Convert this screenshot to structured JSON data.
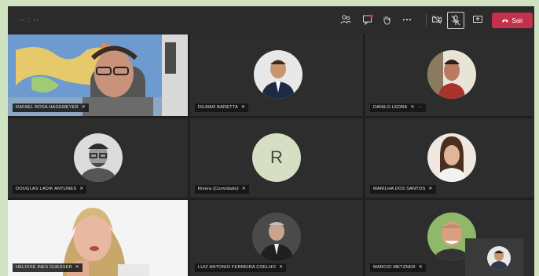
{
  "topbar": {
    "timer": "-- : --",
    "leave_label": "Sair",
    "leave_color": "#c4314b",
    "icons": [
      "participants-icon",
      "chat-icon",
      "raise-hand-icon",
      "more-options-icon",
      "camera-off-icon",
      "mic-off-icon",
      "share-screen-icon",
      "phone-icon"
    ]
  },
  "participants": [
    {
      "name": "RAFAEL ROSA HAGEMEYER",
      "type": "video"
    },
    {
      "name": "DILMAR BARETTA",
      "type": "avatar"
    },
    {
      "name": "DANILO LEDRA",
      "type": "avatar",
      "extra": "···"
    },
    {
      "name": "DOUGLAS LADIK ANTUNES",
      "type": "avatar"
    },
    {
      "name": "Rivera (Convidado)",
      "type": "initial",
      "initial": "R"
    },
    {
      "name": "MARILHA DOS SANTOS",
      "type": "avatar"
    },
    {
      "name": "HELOISE INES GUESSER",
      "type": "video"
    },
    {
      "name": "LUIZ ANTONIO FERREIRA COELHO",
      "type": "avatar"
    },
    {
      "name": "MARCIO METZNER",
      "type": "avatar"
    }
  ],
  "mic_icon": "🎙"
}
